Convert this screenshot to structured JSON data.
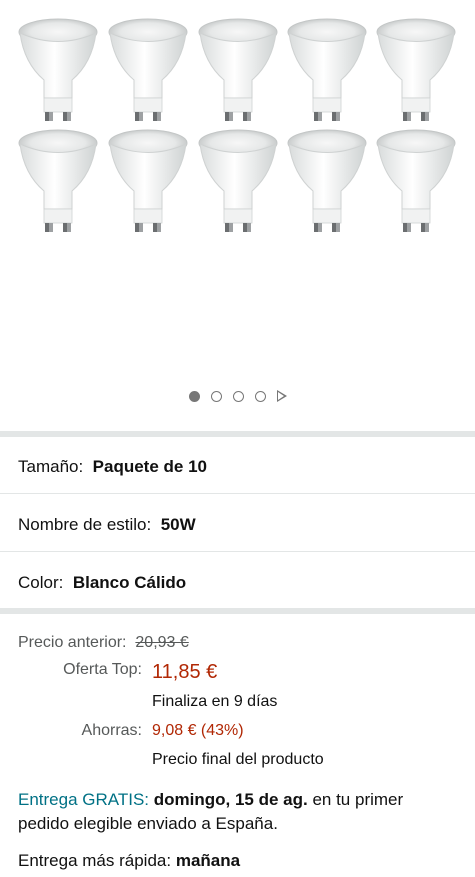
{
  "gallery": {
    "image_alt": "10 bombillas LED GU10",
    "bulb_count": 10,
    "dots": 4,
    "active_dot": 0
  },
  "variations": {
    "size_label": "Tamaño:",
    "size_value": "Paquete de 10",
    "style_label": "Nombre de estilo:",
    "style_value": "50W",
    "color_label": "Color:",
    "color_value": "Blanco Cálido"
  },
  "price": {
    "prev_label": "Precio anterior:",
    "prev_value": "20,93 €",
    "deal_label": "Oferta Top:",
    "deal_value": "11,85 €",
    "ends_text": "Finaliza en 9 días",
    "save_label": "Ahorras:",
    "save_value": "9,08 € (43%)",
    "final_text": "Precio final del producto"
  },
  "delivery": {
    "free_text": "Entrega GRATIS:",
    "date": "domingo, 15 de ag.",
    "rest": "en tu primer pedido elegible enviado a España.",
    "fast_label": "Entrega más rápida:",
    "fast_value": "mañana"
  },
  "colors": {
    "price_red": "#b12704",
    "link_teal": "#007185",
    "muted": "#565959"
  }
}
